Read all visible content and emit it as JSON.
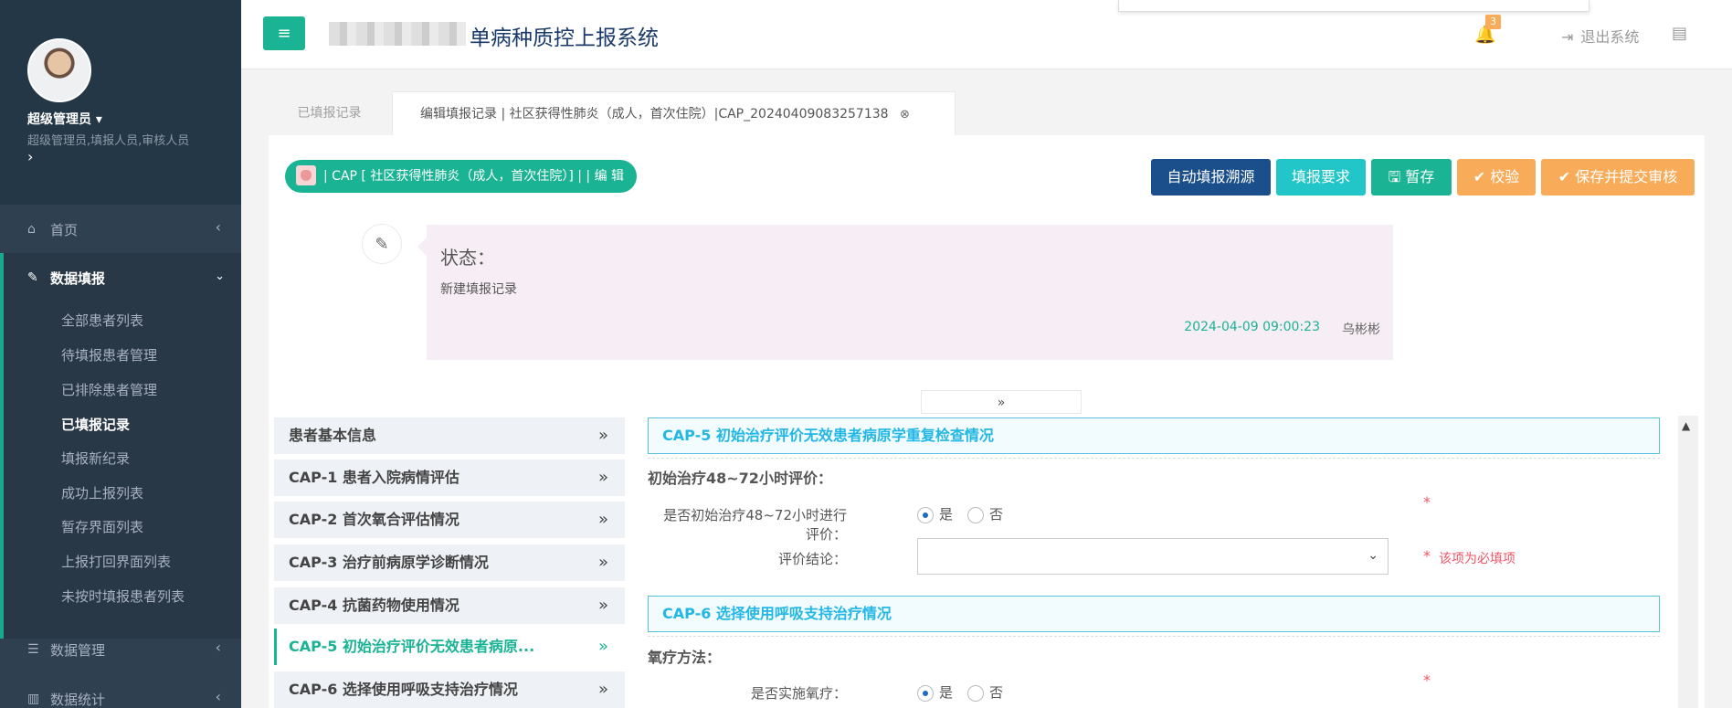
{
  "sidebar": {
    "user_name": "超级管理员 ▾",
    "user_roles": "超级管理员,填报人员,审核人员",
    "more": "›",
    "nav": {
      "home": {
        "label": "首页",
        "icon": "home-icon"
      },
      "data_entry": {
        "label": "数据填报",
        "icon": "edit-icon"
      },
      "data_manage": {
        "label": "数据管理",
        "icon": "list-icon"
      },
      "data_stats": {
        "label": "数据统计",
        "icon": "bar-chart-icon"
      }
    },
    "sub_items": [
      "全部患者列表",
      "待填报患者管理",
      "已排除患者管理",
      "已填报记录",
      "填报新纪录",
      "成功上报列表",
      "暂存界面列表",
      "上报打回界面列表",
      "未按时填报患者列表"
    ],
    "active_sub": "已填报记录"
  },
  "topbar": {
    "menu_icon": "≡",
    "title": "单病种质控上报系统",
    "notification_count": "3",
    "logout": "退出系统"
  },
  "tabs": [
    {
      "label": "已填报记录"
    },
    {
      "label": "编辑填报记录 | 社区获得性肺炎（成人，首次住院）|CAP_20240409083257138",
      "close": "⊗"
    }
  ],
  "record_pill": "| CAP [ 社区获得性肺炎（成人，首次住院）] | | 编 辑",
  "toolbar": {
    "auto_source": "自动填报溯源",
    "requirements": "填报要求",
    "save_temp": "暂存",
    "verify": "校验",
    "submit": "保存并提交审核"
  },
  "timeline": {
    "status_label": "状态：",
    "status_text": "新建填报记录",
    "time": "2024-04-09 09:00:23",
    "user": "乌彬彬"
  },
  "sections": [
    {
      "label": "患者基本信息"
    },
    {
      "label": "CAP-1 患者入院病情评估"
    },
    {
      "label": "CAP-2 首次氧合评估情况"
    },
    {
      "label": "CAP-3 治疗前病原学诊断情况"
    },
    {
      "label": "CAP-4 抗菌药物使用情况"
    },
    {
      "label": "CAP-5 初始治疗评价无效患者病原..."
    },
    {
      "label": "CAP-6 选择使用呼吸支持治疗情况"
    }
  ],
  "active_section_index": 5,
  "form": {
    "cap5": {
      "header": "CAP-5 初始治疗评价无效患者病原学重复检查情况",
      "group": "初始治疗48~72小时评价：",
      "q1_label": "是否初始治疗48~72小时进行评价：",
      "q1_options": [
        "是",
        "否"
      ],
      "q1_selected": "是",
      "q2_label": "评价结论：",
      "q2_value": "",
      "required_msg": "该项为必填项",
      "star": "*"
    },
    "cap6": {
      "header": "CAP-6 选择使用呼吸支持治疗情况",
      "group": "氧疗方法：",
      "q1_label": "是否实施氧疗：",
      "q1_options": [
        "是",
        "否"
      ],
      "q1_selected": "是",
      "star": "*"
    }
  },
  "colors": {
    "primary": "#1ab394",
    "navy": "#1b4f8c",
    "info": "#23c6c8",
    "warning": "#f8ac59",
    "danger": "#ed5565",
    "sidebar": "#2f4050"
  }
}
